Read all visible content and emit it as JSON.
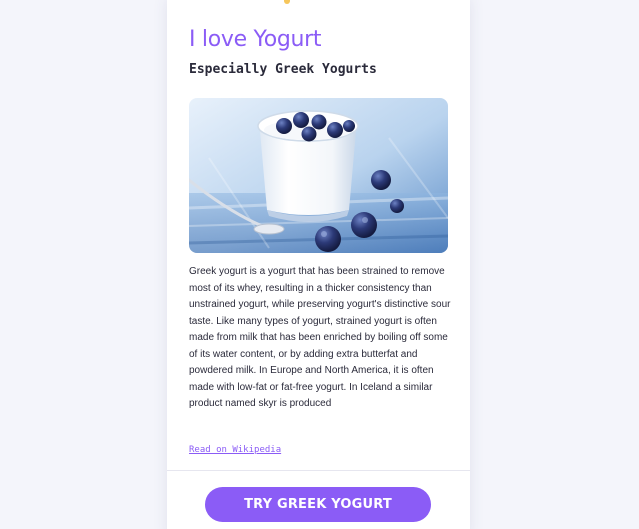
{
  "card": {
    "title": "I love Yogurt",
    "subtitle": "Especially Greek Yogurts",
    "description": "Greek yogurt is a yogurt that has been strained to remove most of its whey, resulting in a thicker consistency than unstrained yogurt, while preserving yogurt's distinctive sour taste. Like many types of yogurt, strained yogurt is often made from milk that has been enriched by boiling off some of its water content, or by adding extra butterfat and powdered milk. In Europe and North America, it is often made with low-fat or fat-free yogurt. In Iceland a similar product named skyr is produced",
    "link_label": "Read on Wikipedia",
    "button_label": "TRY GREEK YOGURT"
  },
  "colors": {
    "accent": "#8b5cf6",
    "text": "#2a2a3a",
    "background": "#f4f5fb",
    "decoration": "#f6c65b"
  },
  "icons": {
    "decoration": "star-icon"
  }
}
